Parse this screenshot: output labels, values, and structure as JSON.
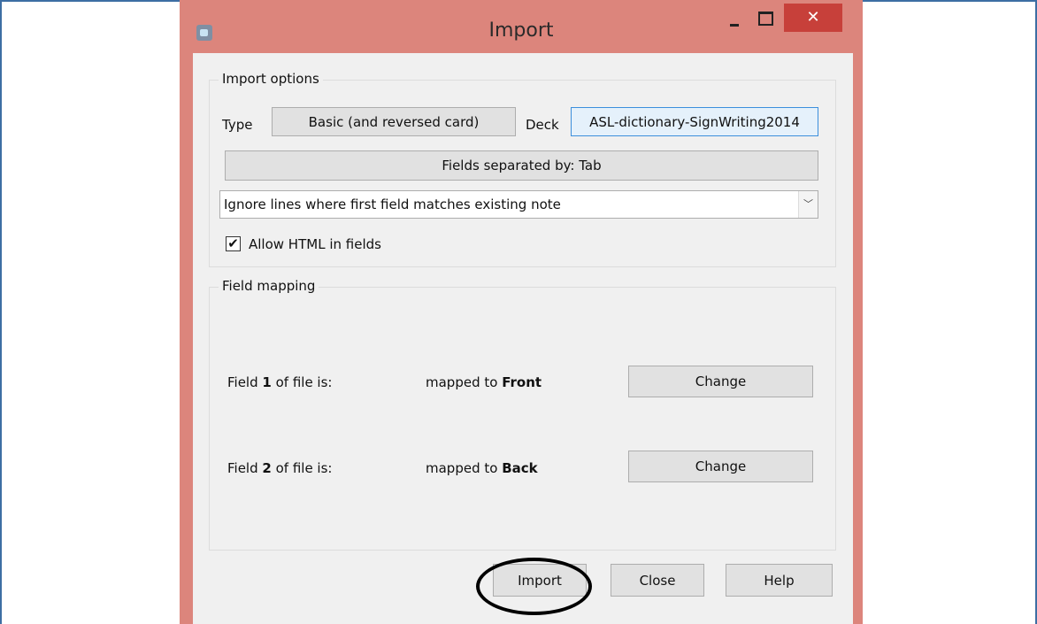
{
  "window": {
    "title": "Import",
    "close_glyph": "✕",
    "icon": "app-icon"
  },
  "import_options": {
    "group_label": "Import options",
    "type_label": "Type",
    "type_value": "Basic (and reversed card)",
    "deck_label": "Deck",
    "deck_value": "ASL-dictionary-SignWriting2014",
    "fields_separated": "Fields separated by: Tab",
    "duplicate_mode": "Ignore lines where first field matches existing note",
    "dropdown_glyph": "﹀",
    "allow_html_checked": true,
    "allow_html_label": "Allow HTML in fields",
    "check_glyph": "✔"
  },
  "field_mapping": {
    "group_label": "Field mapping",
    "rows": [
      {
        "field_prefix": "Field ",
        "field_num": "1",
        "field_suffix": " of file is:",
        "mapped_prefix": "mapped to ",
        "mapped_target": "Front",
        "change_label": "Change"
      },
      {
        "field_prefix": "Field ",
        "field_num": "2",
        "field_suffix": " of file is:",
        "mapped_prefix": "mapped to ",
        "mapped_target": "Back",
        "change_label": "Change"
      }
    ]
  },
  "footer": {
    "import_label": "Import",
    "close_label": "Close",
    "help_label": "Help"
  },
  "colors": {
    "titlebar": "#dc857c",
    "close_button": "#c7403a",
    "dialog_bg": "#f0f0f0",
    "deck_focus_border": "#3c8fdc"
  }
}
